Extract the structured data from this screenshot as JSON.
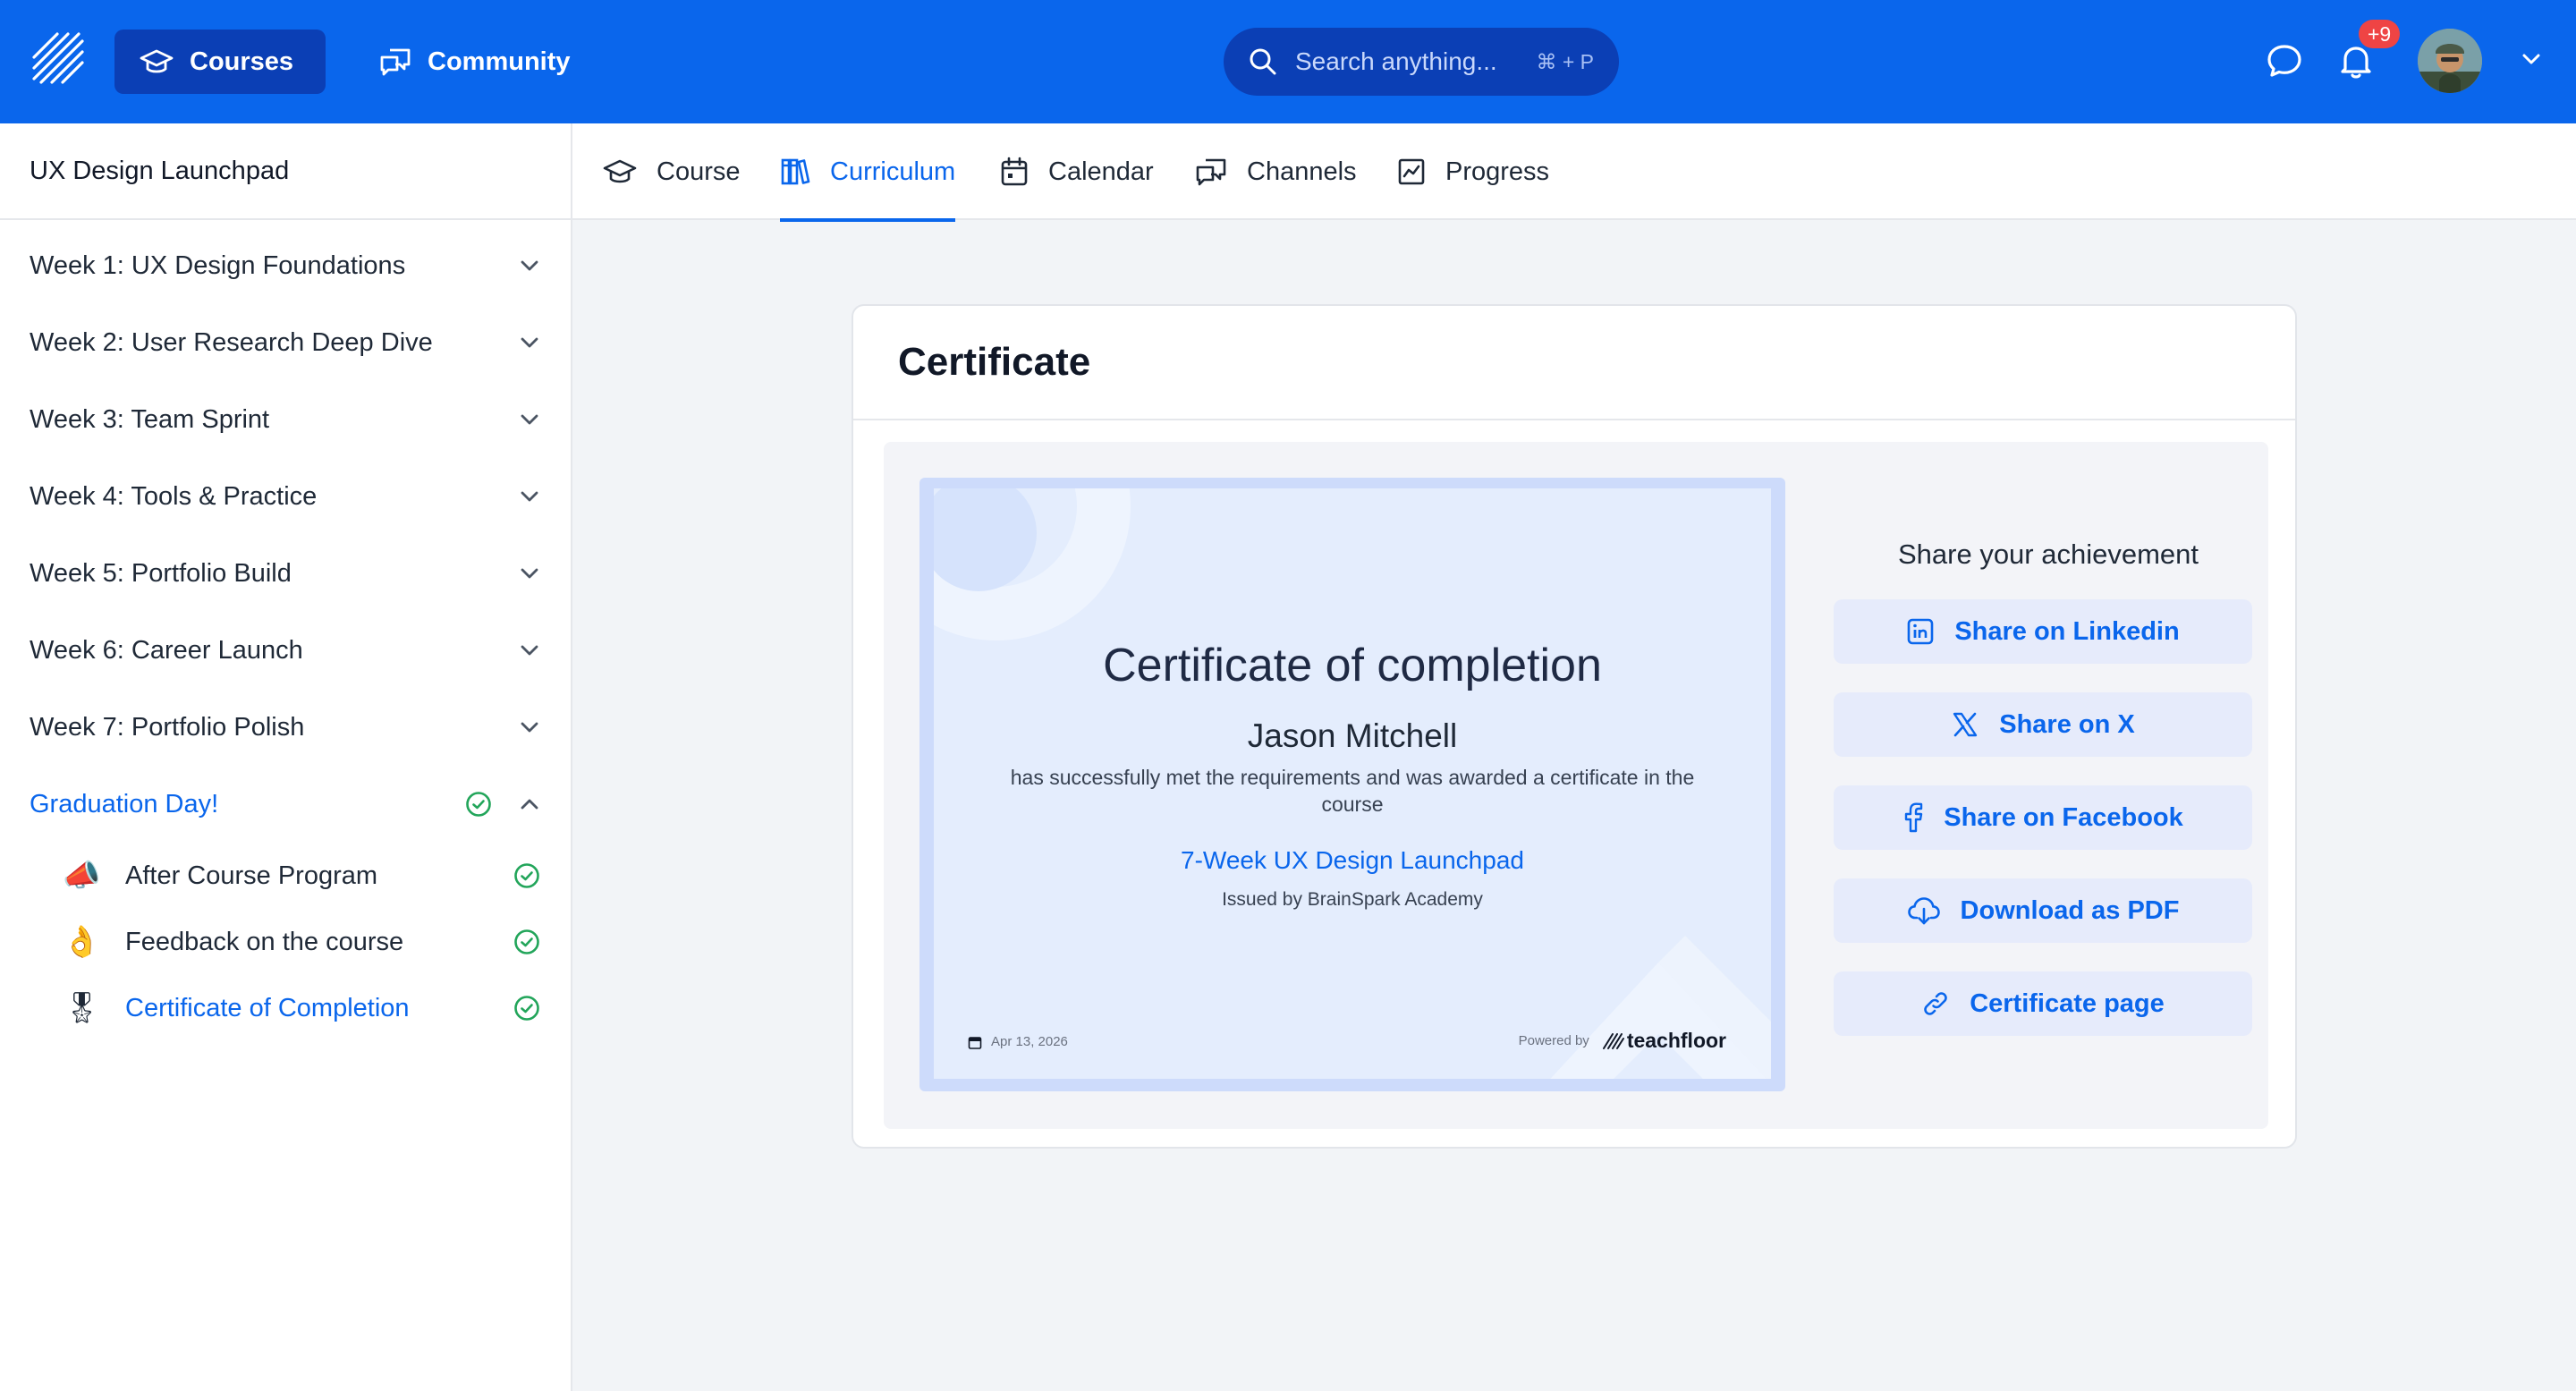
{
  "colors": {
    "brand": "#0a66ec",
    "brand_dark": "#0b3fb5",
    "success": "#22a55a",
    "badge": "#ef4444"
  },
  "topbar": {
    "logo_icon": "brand-logo-icon",
    "courses_label": "Courses",
    "community_label": "Community",
    "search_placeholder": "Search anything...",
    "search_shortcut": "⌘ + P",
    "notification_badge": "+9"
  },
  "sidebar": {
    "course_title": "UX Design Launchpad",
    "weeks": [
      {
        "label": "Week 1: UX Design Foundations"
      },
      {
        "label": "Week 2: User Research Deep Dive"
      },
      {
        "label": "Week 3: Team Sprint"
      },
      {
        "label": "Week 4: Tools & Practice"
      },
      {
        "label": "Week 5: Portfolio Build"
      },
      {
        "label": "Week 6: Career Launch"
      },
      {
        "label": "Week 7: Portfolio Polish"
      },
      {
        "label": "Graduation Day!"
      }
    ],
    "graduation_items": [
      {
        "emoji": "📣",
        "label": "After Course Program"
      },
      {
        "emoji": "👌",
        "label": "Feedback on the course"
      },
      {
        "emoji": "🎖",
        "label": "Certificate of Completion"
      }
    ]
  },
  "tabs": [
    {
      "label": "Course",
      "icon": "graduation-cap-icon"
    },
    {
      "label": "Curriculum",
      "icon": "books-icon"
    },
    {
      "label": "Calendar",
      "icon": "calendar-icon"
    },
    {
      "label": "Channels",
      "icon": "chat-icon"
    },
    {
      "label": "Progress",
      "icon": "chart-icon"
    }
  ],
  "card": {
    "title": "Certificate",
    "certificate": {
      "title": "Certificate of completion",
      "recipient": "Jason Mitchell",
      "description": "has successfully met the requirements and was awarded a certificate in the course",
      "course": "7-Week UX Design Launchpad",
      "issuer": "Issued by BrainSpark Academy",
      "date": "Apr 13, 2026",
      "powered_by": "Powered by",
      "brand": "teachfloor"
    },
    "share": {
      "title": "Share your achievement",
      "buttons": [
        {
          "label": "Share on Linkedin",
          "icon": "linkedin-icon"
        },
        {
          "label": "Share on X",
          "icon": "x-icon"
        },
        {
          "label": "Share on Facebook",
          "icon": "facebook-icon"
        },
        {
          "label": "Download as PDF",
          "icon": "cloud-download-icon"
        },
        {
          "label": "Certificate page",
          "icon": "link-icon"
        }
      ]
    }
  }
}
